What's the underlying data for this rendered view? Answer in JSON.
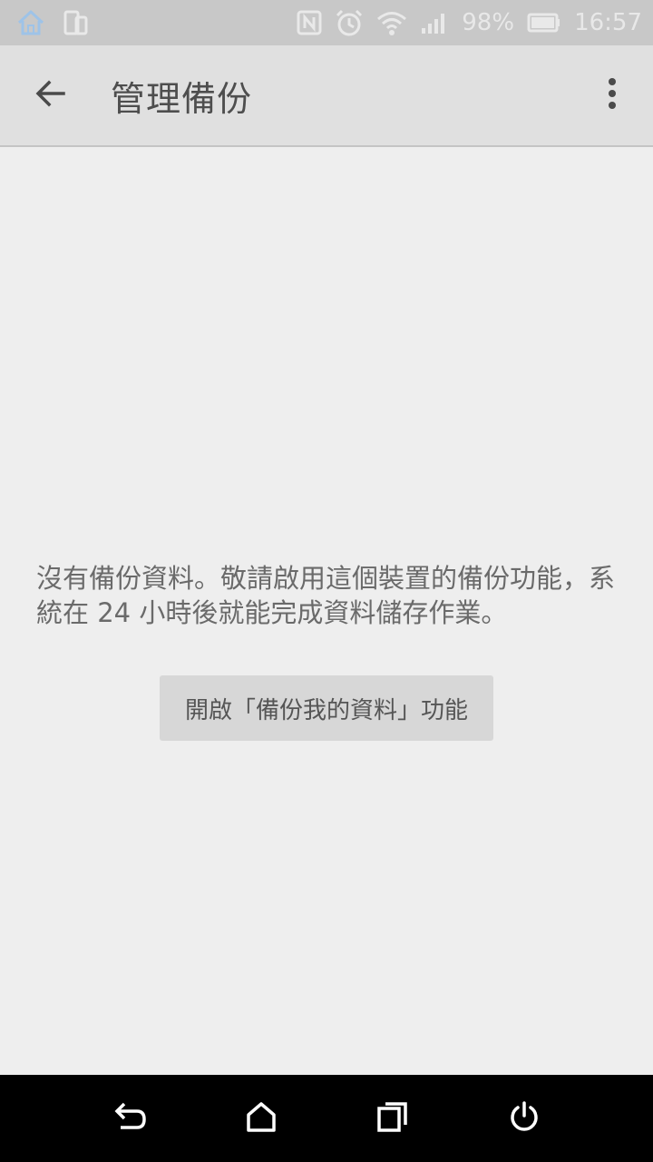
{
  "status_bar": {
    "battery_percent": "98%",
    "time": "16:57",
    "icons": [
      "home-notification-icon",
      "device-icon",
      "nfc-icon",
      "alarm-icon",
      "wifi-icon",
      "signal-icon",
      "battery-icon"
    ]
  },
  "toolbar": {
    "title": "管理備份",
    "back_icon": "arrow-back-icon",
    "overflow_icon": "more-vert-icon"
  },
  "main": {
    "message": "沒有備份資料。敬請啟用這個裝置的備份功能，系統在 24 小時後就能完成資料儲存作業。",
    "enable_button_label": "開啟「備份我的資料」功能"
  },
  "nav_bar": {
    "icons": [
      "back-icon",
      "home-icon",
      "recents-icon",
      "power-icon"
    ]
  }
}
